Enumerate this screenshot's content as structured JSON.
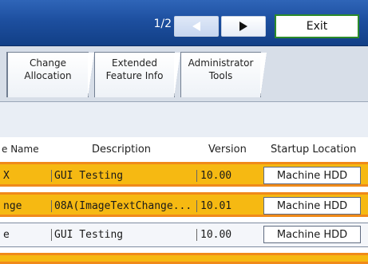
{
  "header": {
    "page_indicator": "1/2",
    "exit_label": "Exit"
  },
  "tabs": [
    {
      "label": "Change\nAllocation"
    },
    {
      "label": "Extended\nFeature Info"
    },
    {
      "label": "Administrator\nTools"
    }
  ],
  "table": {
    "columns": {
      "name": "e Name",
      "description": "Description",
      "version": "Version",
      "startup_location": "Startup Location"
    },
    "rows": [
      {
        "name": "X",
        "description": "GUI Testing",
        "version": "10.00",
        "startup_location": "Machine HDD",
        "selected": true
      },
      {
        "name": "nge",
        "description": "08A(ImageTextChange...",
        "version": "10.01",
        "startup_location": "Machine HDD",
        "selected": true
      },
      {
        "name": "e",
        "description": "GUI Testing",
        "version": "10.00",
        "startup_location": "Machine HDD",
        "selected": false
      }
    ]
  },
  "colors": {
    "header_blue": "#1d4f9f",
    "selected_row": "#f6b912",
    "selected_border": "#f08a1a",
    "exit_border": "#2c8b2a"
  }
}
